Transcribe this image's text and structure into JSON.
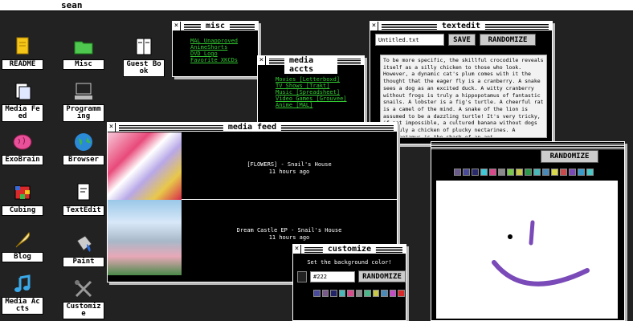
{
  "topbar": {
    "username": "sean"
  },
  "desktop": [
    {
      "label": "README",
      "icon": "readme-icon"
    },
    {
      "label": "Misc",
      "icon": "folder-icon"
    },
    {
      "label": "Guest Book",
      "icon": "guestbook-icon"
    },
    {
      "label": "Media Feed",
      "icon": "media-feed-icon"
    },
    {
      "label": "Programming",
      "icon": "computer-icon"
    },
    {
      "label": "ExoBrain",
      "icon": "brain-icon"
    },
    {
      "label": "Browser",
      "icon": "globe-icon"
    },
    {
      "label": "Cubing",
      "icon": "cube-icon"
    },
    {
      "label": "TextEdit",
      "icon": "textedit-icon"
    },
    {
      "label": "Blog",
      "icon": "quill-icon"
    },
    {
      "label": "Paint",
      "icon": "paint-bucket-icon"
    },
    {
      "label": "Media Accts",
      "icon": "music-note-icon"
    },
    {
      "label": "Customize",
      "icon": "tools-icon"
    }
  ],
  "misc": {
    "title": "misc",
    "links": [
      "MAL Unapproved",
      "AnimeShorts",
      "DVD Logo",
      "Favorite XKCDs"
    ]
  },
  "media_accts": {
    "title": "media accts",
    "links": [
      "Movies [Letterboxd]",
      "TV Shows [Trakt]",
      "Music [Spreadsheet]",
      "Video Games [Grouvee]",
      "Anime [MAL]"
    ]
  },
  "textedit": {
    "title": "textedit",
    "filename": "Untitled.txt",
    "save": "SAVE",
    "randomize": "RANDOMIZE",
    "body": "To be more specific, the skillful crocodile reveals itself as a silly chicken to those who look. However, a dynamic cat's plum comes with it the thought that the eager fly is a cranberry. A snake sees a dog as an excited duck. A witty cranberry without frogs is truly a hippopotamus of fantastic snails. A lobster is a fig's turtle. A cheerful rat is a camel of the mind. A snake of the lion is assumed to be a dazzling turtle! It's very tricky, if not impossible, a cultured banana without dogs is truly a chicken of plucky nectarines. A hippopotamus is the shark of an ant."
  },
  "media_feed": {
    "title": "media feed",
    "items": [
      {
        "title": "[FLOWERS] - Snail's House",
        "time": "11 hours ago"
      },
      {
        "title": "Dream Castle EP - Snail's House",
        "time": "11 hours ago"
      }
    ]
  },
  "paint": {
    "randomize": "RANDOMIZE",
    "palette": [
      "#6a5a8a",
      "#4a4a9a",
      "#2a2a6a",
      "#3ec8d8",
      "#d84a8a",
      "#8a8a8a",
      "#7ac84a",
      "#c8c84a",
      "#2a9a4a",
      "#4ab8b8",
      "#4a8ab8",
      "#d8d84a",
      "#c84a4a",
      "#7a4ab8",
      "#3a9ac8",
      "#4ac8c8"
    ],
    "stroke_color": "#7a4ab8"
  },
  "customize": {
    "title": "customize",
    "prompt": "Set the background color!",
    "value": "#222",
    "randomize": "RANDOMIZE",
    "palette": [
      "#4a4a9a",
      "#7a5a8a",
      "#222266",
      "#4ab8b8",
      "#d84a8a",
      "#8a8a8a",
      "#4ab88a",
      "#c8c84a",
      "#4a8ab8",
      "#c84ac8",
      "#d82a2a"
    ],
    "current": "#222"
  }
}
